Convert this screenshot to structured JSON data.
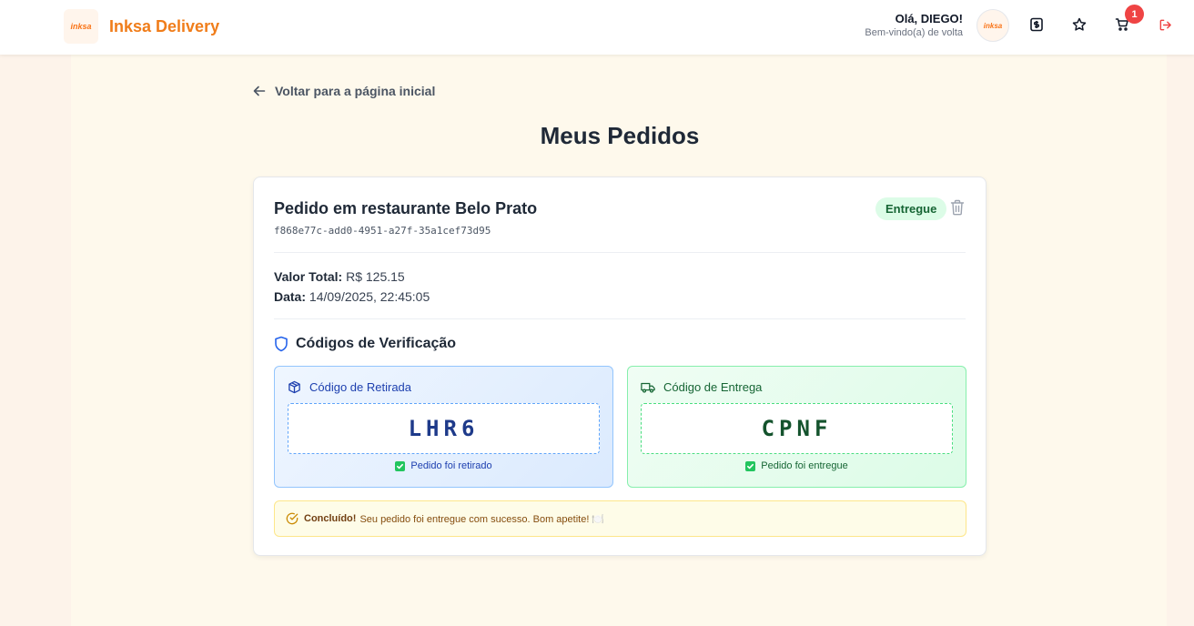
{
  "header": {
    "logo_text": "inksa",
    "brand_name": "Inksa Delivery",
    "greeting": "Olá, DIEGO!",
    "welcome": "Bem-vindo(a) de volta",
    "avatar_text": "inksa",
    "cart_count": "1",
    "icons": [
      "dollar-icon",
      "star-icon",
      "cart-icon",
      "logout-icon"
    ]
  },
  "nav": {
    "back_label": "Voltar para a página inicial"
  },
  "page": {
    "title": "Meus Pedidos"
  },
  "order": {
    "title": "Pedido em restaurante Belo Prato",
    "id": "f868e77c-add0-4951-a27f-35a1cef73d95",
    "status": "Entregue",
    "total_label": "Valor Total:",
    "total_value": "R$ 125.15",
    "date_label": "Data:",
    "date_value": "14/09/2025, 22:45:05"
  },
  "verification": {
    "title": "Códigos de Verificação",
    "pickup": {
      "label": "Código de Retirada",
      "code": "LHR6",
      "status": "Pedido foi retirado"
    },
    "delivery": {
      "label": "Código de Entrega",
      "code": "CPNF",
      "status": "Pedido foi entregue"
    }
  },
  "alert": {
    "strong": "Concluído!",
    "text": "Seu pedido foi entregue com sucesso. Bom apetite! 🍽️"
  },
  "colors": {
    "brand": "#f07d1a",
    "badge": "#ef4444",
    "status_bg": "#dcfce7",
    "pickup_accent": "#1e40af",
    "delivery_accent": "#166534"
  }
}
